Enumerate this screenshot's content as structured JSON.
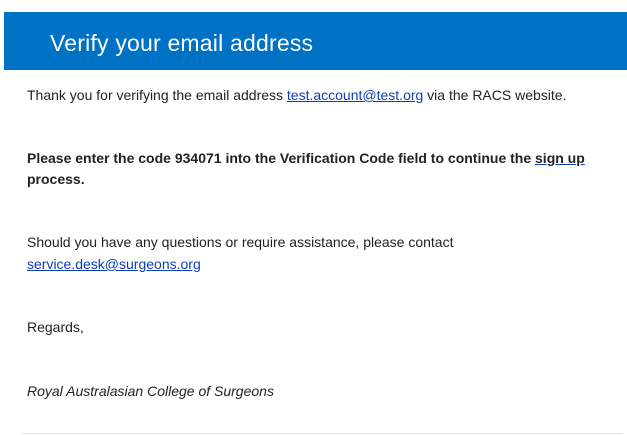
{
  "header": {
    "title": "Verify your email address",
    "background_color": "#0072c6"
  },
  "message": {
    "p1_before": "Thank you for verifying the email address ",
    "p1_email": "test.account@test.org",
    "p1_after": " via the RACS website.",
    "p2_text": "Please enter the code 934071 into the Verification Code field to continue the ",
    "p2_link": "sign up",
    "p2_end": " process.",
    "p3_text": "Should you have any questions or require assistance, please contact",
    "p3_email": "service.desk@surgeons.org",
    "p4_text": "Regards,",
    "p5_text": "Royal Australasian College of Surgeons"
  },
  "colors": {
    "link": "#0b3fb8",
    "text": "#222222"
  }
}
